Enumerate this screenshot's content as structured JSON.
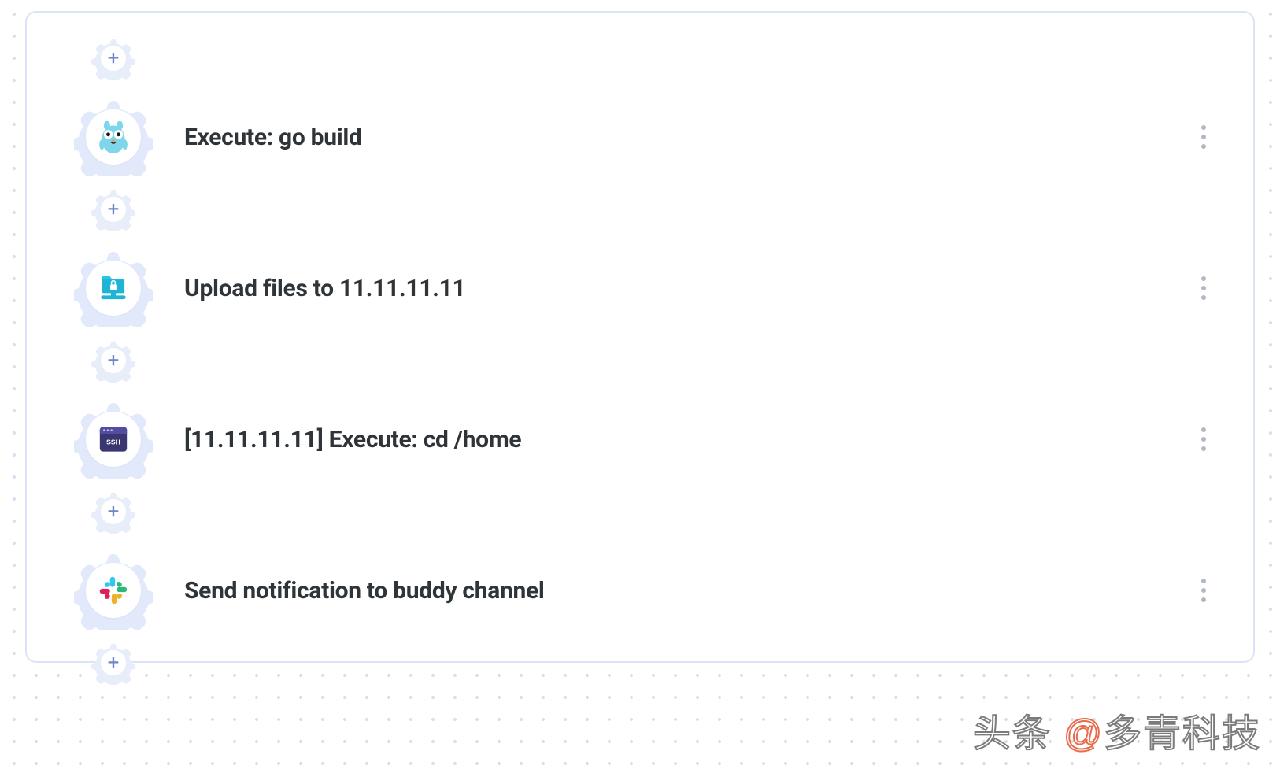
{
  "steps": [
    {
      "icon": "gopher-icon",
      "label": "Execute: go build"
    },
    {
      "icon": "upload-lock-icon",
      "label": "Upload files to 11.11.11.11"
    },
    {
      "icon": "ssh-terminal-icon",
      "label": "[11.11.11.11] Execute: cd /home"
    },
    {
      "icon": "slack-icon",
      "label": "Send notification to buddy channel"
    }
  ],
  "watermark": {
    "prefix": "头条",
    "at": "@",
    "name": "多青科技"
  }
}
